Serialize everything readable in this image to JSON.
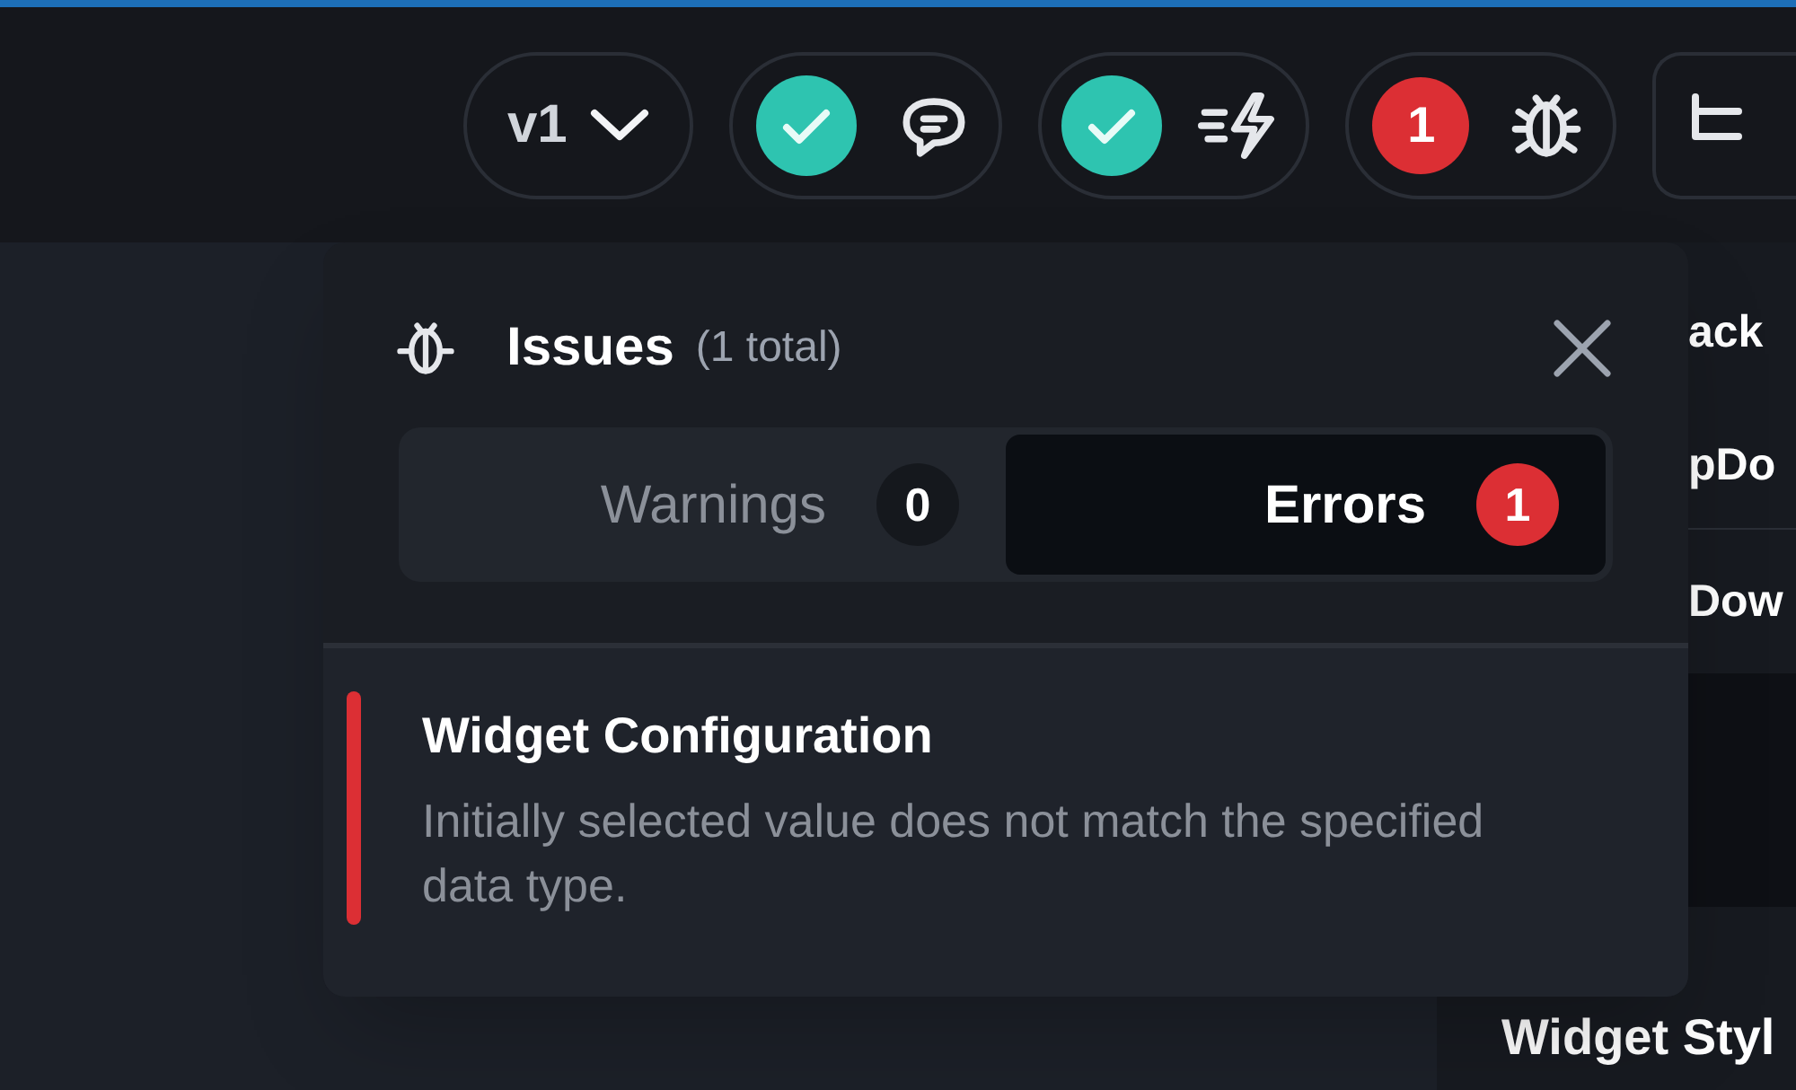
{
  "toolbar": {
    "version_menu": {
      "label": "v1"
    },
    "status_buttons": [
      {
        "kind": "ok"
      },
      {
        "kind": "ok"
      },
      {
        "kind": "count",
        "count": "1"
      }
    ]
  },
  "issues_panel": {
    "title": "Issues",
    "total": "(1 total)",
    "tabs": [
      {
        "label": "Warnings",
        "count": "0",
        "selected": false
      },
      {
        "label": "Errors",
        "count": "1",
        "selected": true
      }
    ],
    "issues": [
      {
        "title": "Widget Configuration",
        "message": "Initially selected value does not match the specified data type."
      }
    ]
  },
  "side_panel": {
    "items": [
      "ack",
      "pDo",
      "Dow",
      "Widget Styl"
    ]
  }
}
